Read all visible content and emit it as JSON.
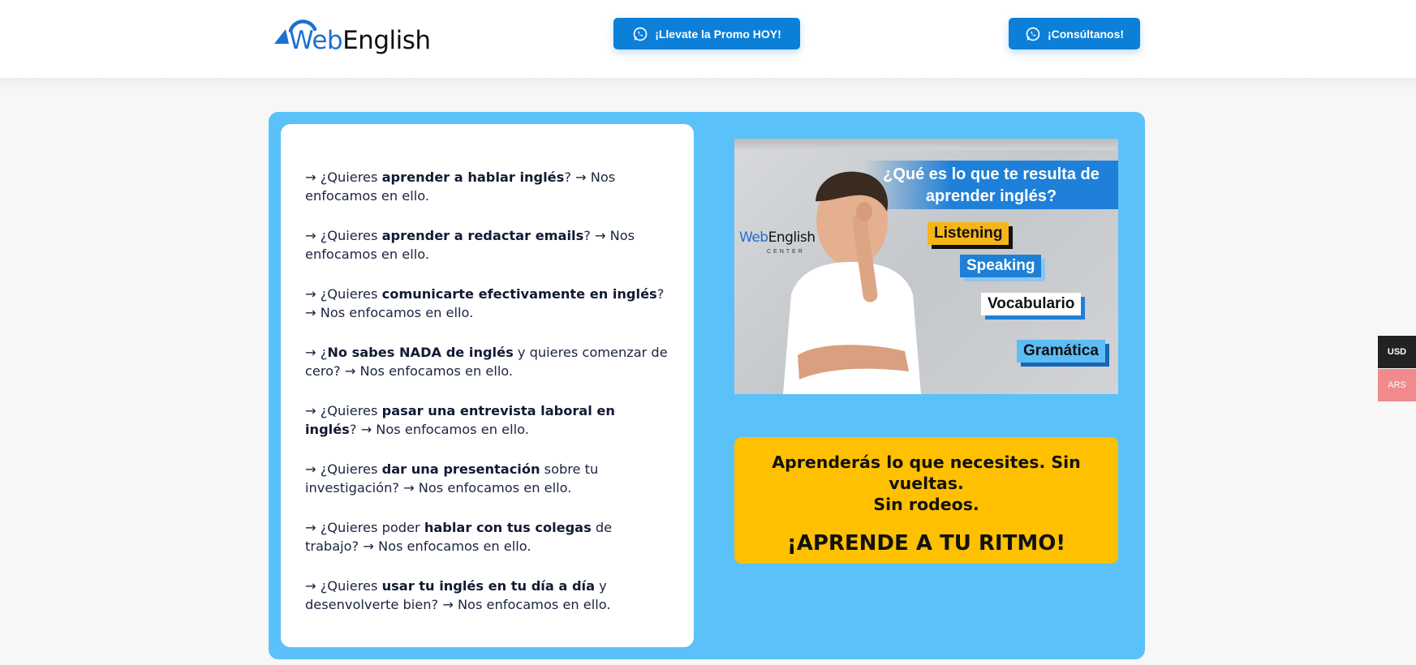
{
  "header": {
    "logo": {
      "web": "Web",
      "english": "English"
    },
    "promo_button": {
      "label": "¡Llevate la Promo HOY!",
      "icon": "whatsapp-icon"
    },
    "consult_button": {
      "label": "¡Consúltanos!",
      "icon": "whatsapp-icon"
    }
  },
  "questions": [
    {
      "pre": "→  ¿Quieres ",
      "bold": "aprender a hablar inglés",
      "post": "? → Nos enfocamos en ello."
    },
    {
      "pre": "→  ¿Quieres ",
      "bold": "aprender a redactar emails",
      "post": "? → Nos enfocamos en ello."
    },
    {
      "pre": "→  ¿Quieres ",
      "bold": "comunicarte efectivamente en inglés",
      "post": "? → Nos enfocamos en ello."
    },
    {
      "pre": "→  ¿",
      "bold": "No sabes NADA de inglés",
      "post": " y quieres comenzar de cero? → Nos enfocamos en ello."
    },
    {
      "pre": "→  ¿Quieres ",
      "bold": "pasar una entrevista laboral en inglés",
      "post": "? → Nos enfocamos en ello."
    },
    {
      "pre": "→  ¿Quieres ",
      "bold": "dar una presentación",
      "post": " sobre tu investigación? → Nos enfocamos en ello."
    },
    {
      "pre": "→  ¿Quieres poder ",
      "bold": "hablar con tus colegas",
      "post": " de trabajo? → Nos enfocamos en ello."
    },
    {
      "pre": "→  ¿Quieres ",
      "bold": "usar tu inglés en tu día a día",
      "post": " y desenvolverte bien? → Nos enfocamos en ello."
    }
  ],
  "promo_image": {
    "question": "¿Qué es lo que te resulta de aprender inglés?",
    "logo_web": "Web",
    "logo_english": "English",
    "logo_sub": "CENTER",
    "tags": {
      "listening": "Listening",
      "speaking": "Speaking",
      "vocabulario": "Vocabulario",
      "gramatica": "Gramática"
    }
  },
  "callout": {
    "line1": "Aprenderás lo que necesites. Sin vueltas.",
    "line2": "Sin rodeos.",
    "headline": "¡APRENDE A TU RITMO!"
  },
  "currency": {
    "usd": "USD",
    "ars": "ARS",
    "selected": "USD"
  },
  "colors": {
    "accent_blue": "#0c7fd9",
    "section_bg": "#5ac2f8",
    "callout_yellow": "#ffc000"
  }
}
